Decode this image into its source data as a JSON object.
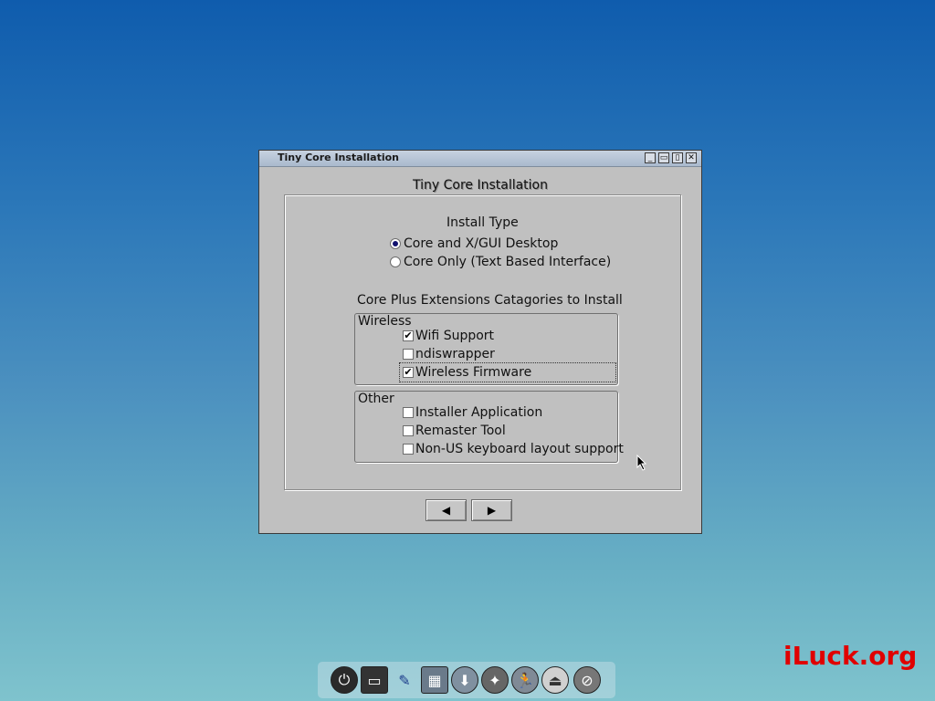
{
  "window": {
    "title": "Tiny Core Installation",
    "heading": "Tiny Core Installation",
    "buttons": {
      "minimize": "_",
      "restore": "▭",
      "maximize": "▯",
      "close": "✕"
    }
  },
  "install_type": {
    "label": "Install Type",
    "options": [
      {
        "label": "Core and X/GUI Desktop",
        "selected": true
      },
      {
        "label": "Core Only (Text Based Interface)",
        "selected": false
      }
    ]
  },
  "extensions": {
    "label": "Core Plus Extensions Catagories to Install",
    "groups": [
      {
        "title": "Wireless",
        "items": [
          {
            "label": "Wifi Support",
            "checked": true
          },
          {
            "label": "ndiswrapper",
            "checked": false
          },
          {
            "label": "Wireless Firmware",
            "checked": true
          }
        ]
      },
      {
        "title": "Other",
        "items": [
          {
            "label": "Installer Application",
            "checked": false
          },
          {
            "label": "Remaster Tool",
            "checked": false
          },
          {
            "label": "Non-US keyboard layout support",
            "checked": false
          }
        ]
      }
    ]
  },
  "nav": {
    "back": "◀",
    "next": "▶"
  },
  "check_mark": "✔",
  "dock": {
    "icons": [
      "power-icon",
      "terminal-icon",
      "editor-icon",
      "control-panel-icon",
      "apps-icon",
      "wand-icon",
      "run-icon",
      "mount-icon",
      "cancel-icon"
    ],
    "glyphs": [
      "⏻",
      "▭",
      "✎",
      "▦",
      "⬇",
      "✦",
      "🏃",
      "⏏",
      "⊘"
    ]
  },
  "watermark": "iLuck.org",
  "colors": {
    "radio_dot": "#10106e",
    "watermark": "#e00000"
  }
}
